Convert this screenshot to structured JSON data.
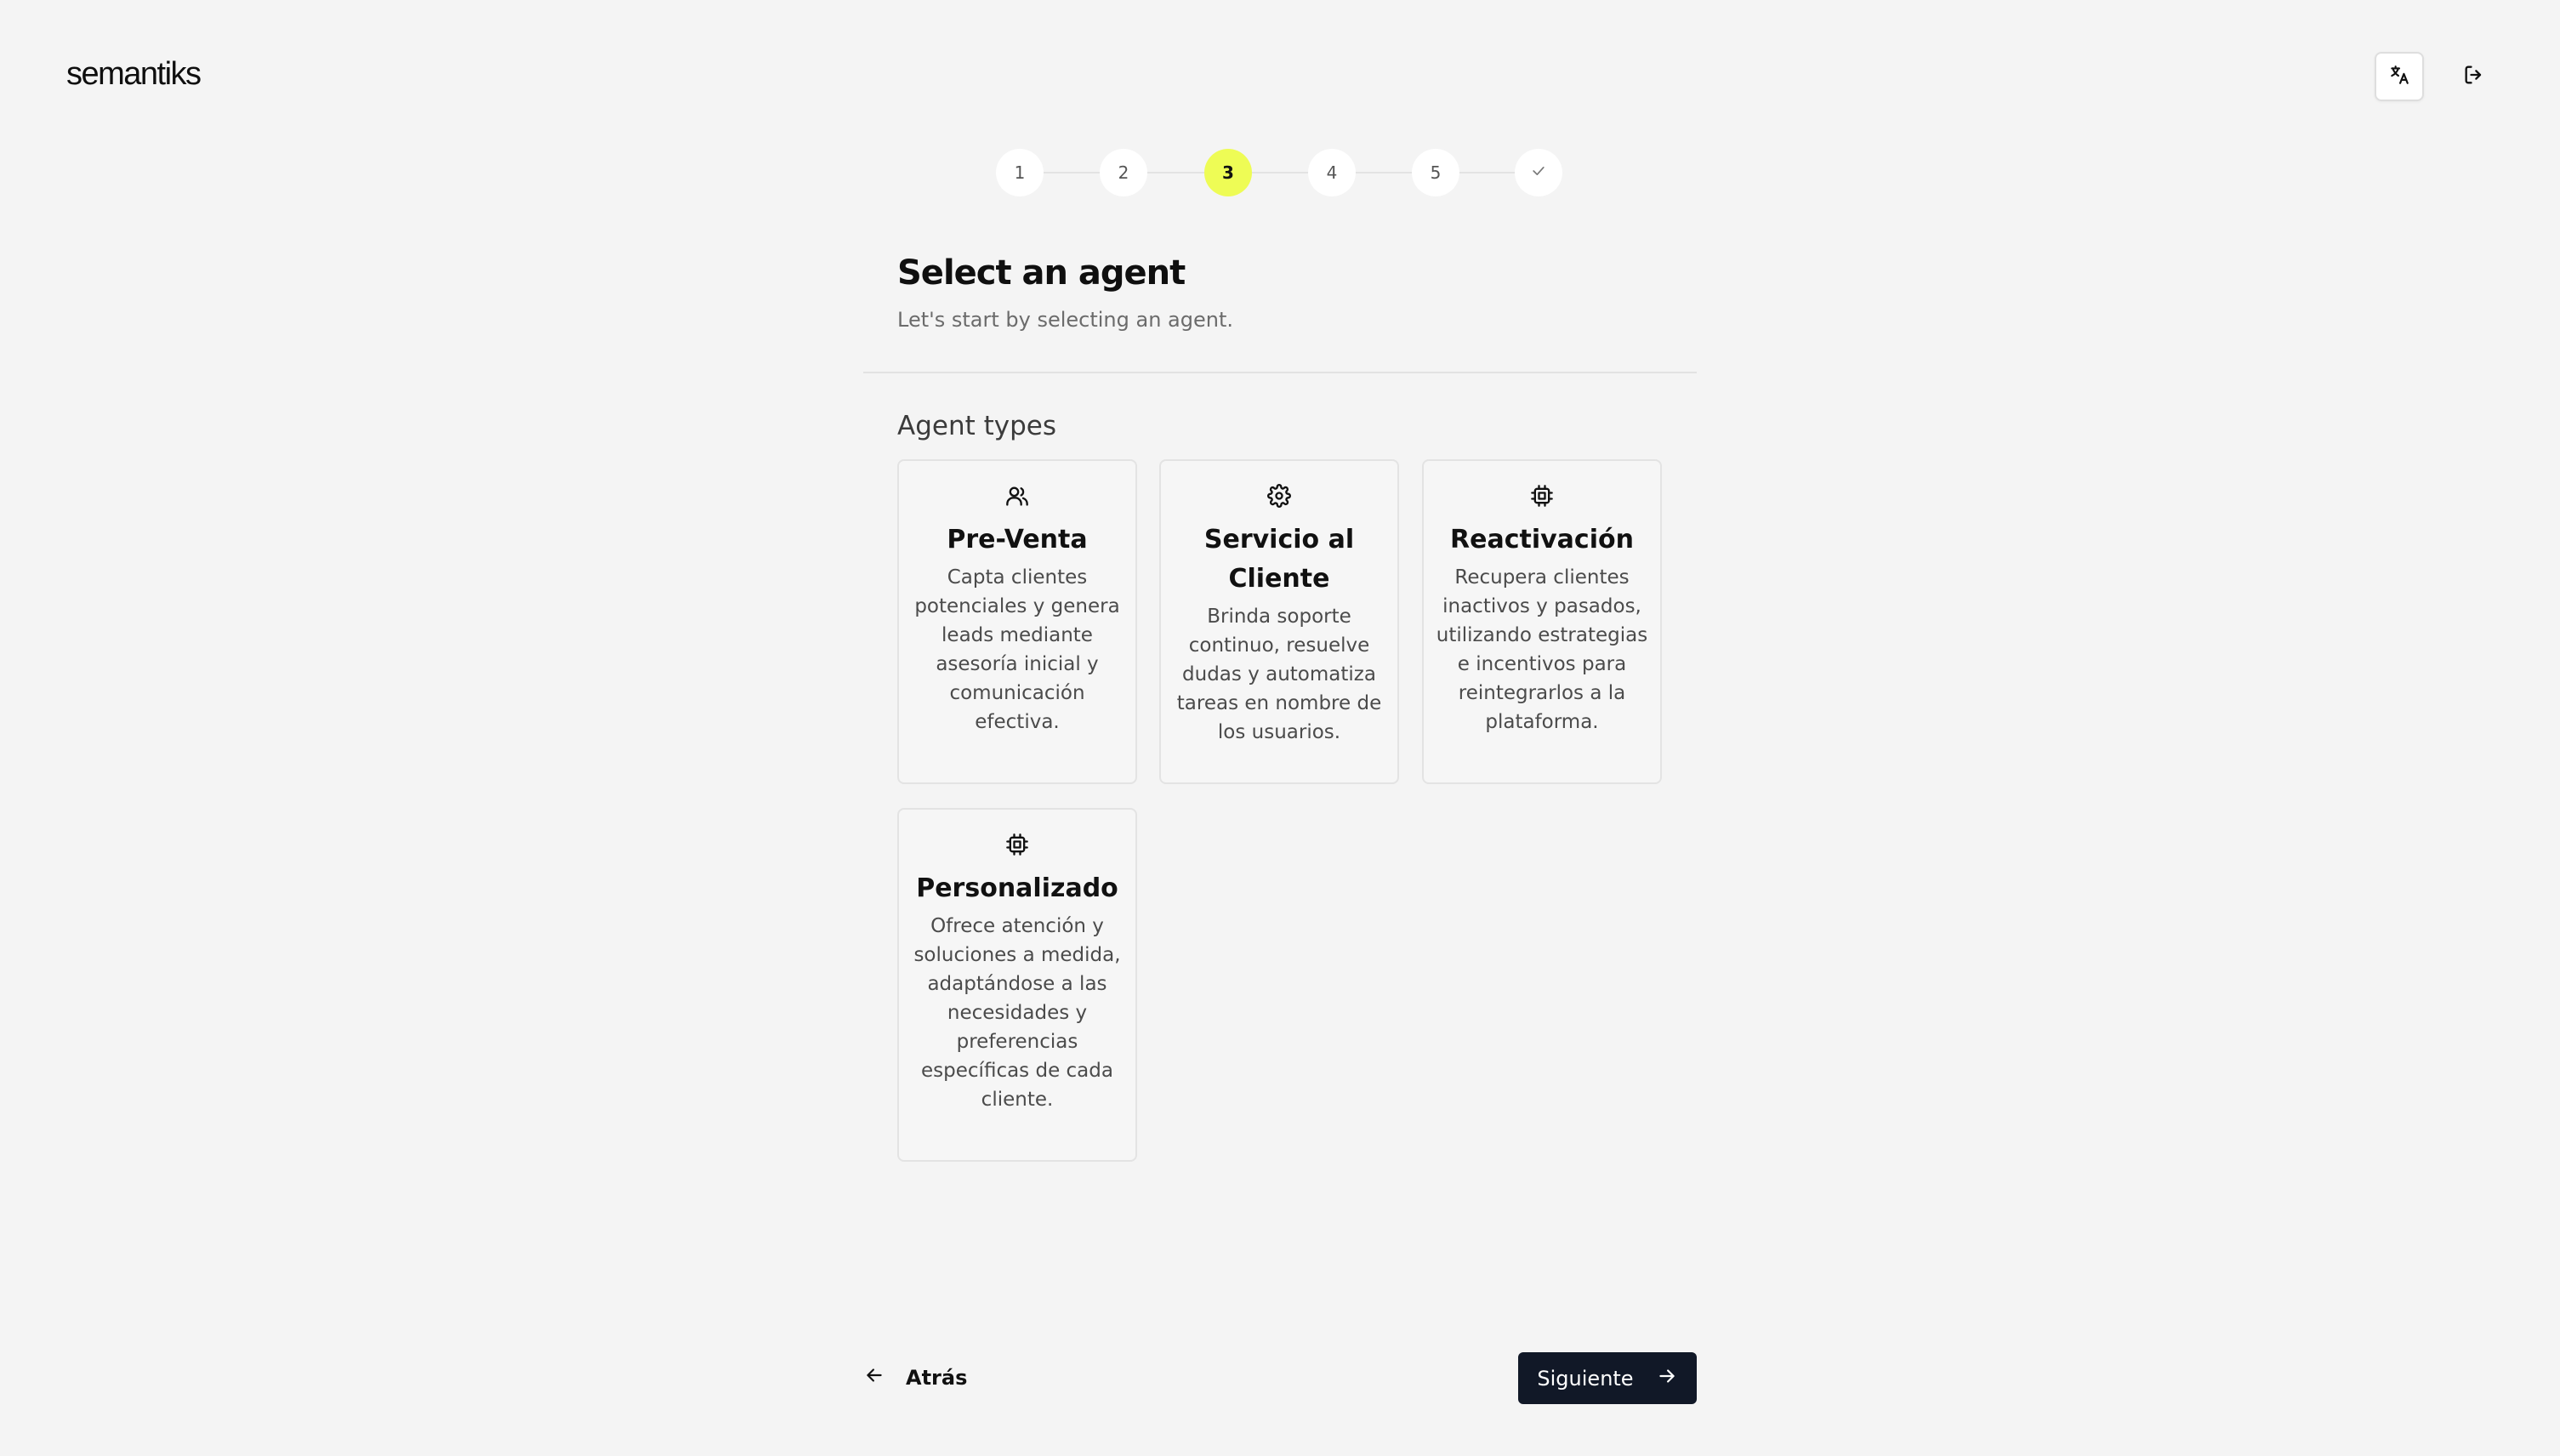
{
  "header": {
    "logo": "semantiks"
  },
  "stepper": {
    "steps": [
      "1",
      "2",
      "3",
      "4",
      "5"
    ],
    "active_step": 3
  },
  "main": {
    "title": "Select an agent",
    "subtitle": "Let's start by selecting an agent.",
    "section_heading": "Agent types",
    "cards": [
      {
        "title": "Pre-Venta",
        "description": "Capta clientes potenciales y genera leads mediante asesoría inicial y comunicación efectiva.",
        "icon": "users-icon"
      },
      {
        "title": "Servicio al Cliente",
        "description": "Brinda soporte continuo, resuelve dudas y automatiza tareas en nombre de los usuarios.",
        "icon": "gear-icon"
      },
      {
        "title": "Reactivación",
        "description": "Recupera clientes inactivos y pasados, utilizando estrategias e incentivos para reintegrarlos a la plataforma.",
        "icon": "cpu-icon"
      },
      {
        "title": "Personalizado",
        "description": "Ofrece atención y soluciones a medida, adaptándose a las necesidades y preferencias específicas de cada cliente.",
        "icon": "cpu-icon"
      }
    ]
  },
  "footer": {
    "back_label": "Atrás",
    "next_label": "Siguiente"
  },
  "colors": {
    "background": "#f4f4f4",
    "active_step": "#eefc55",
    "primary_button": "#111827"
  }
}
